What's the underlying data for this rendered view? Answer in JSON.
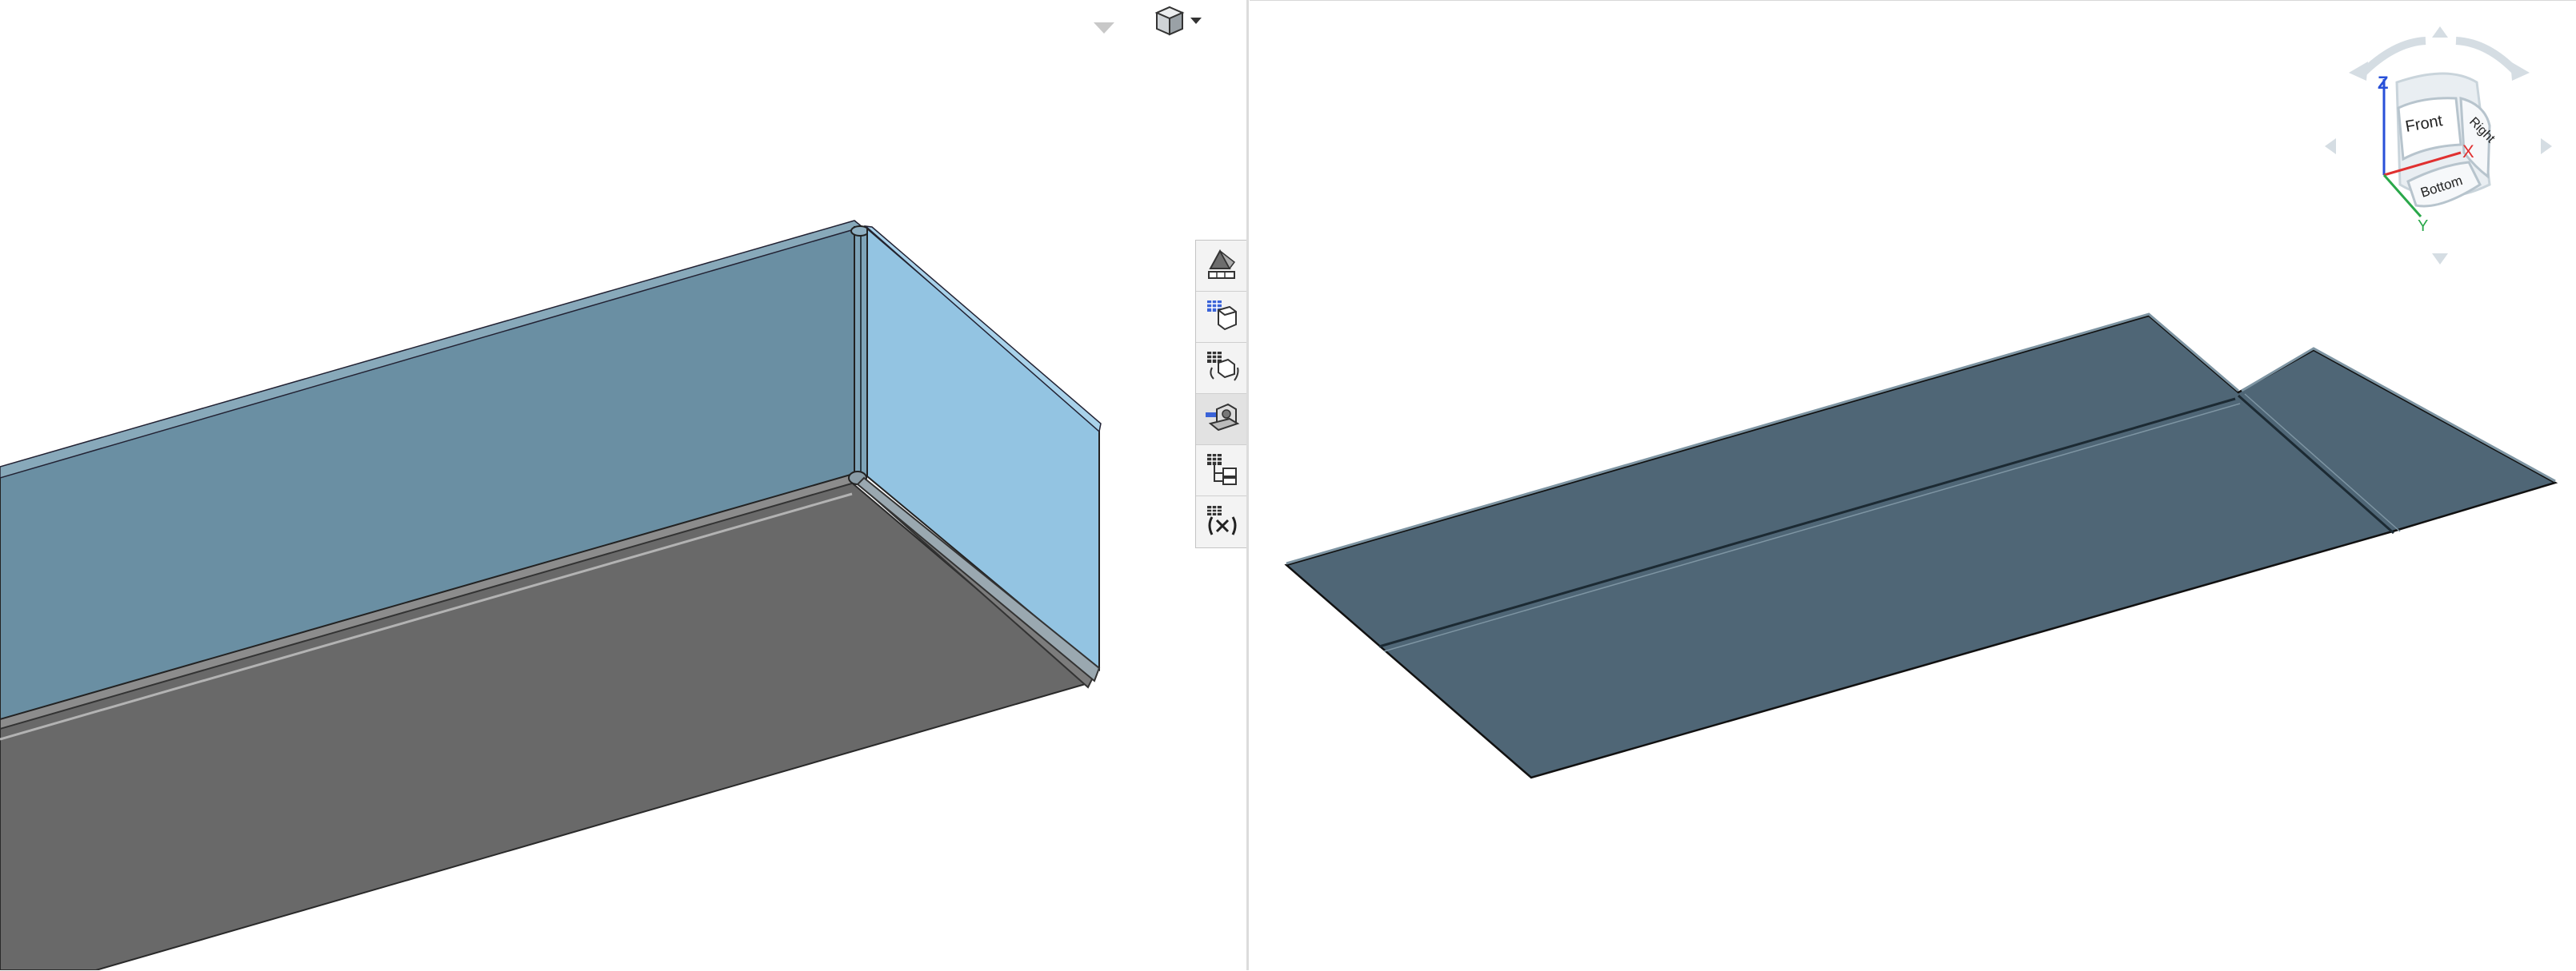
{
  "viewports": {
    "left": {
      "name": "3D model view"
    },
    "right": {
      "name": "Flat pattern view"
    }
  },
  "view_toolbar": {
    "view_cube_icon": "cube-icon",
    "dropdown_icon": "caret-down-icon",
    "collapse_icon": "chevron-down-icon"
  },
  "side_toolbar": {
    "tools": [
      {
        "icon": "appearance-icon"
      },
      {
        "icon": "mesh-cube-icon"
      },
      {
        "icon": "mesh-parts-icon"
      },
      {
        "icon": "section-view-icon"
      },
      {
        "icon": "mesh-tree-icon"
      },
      {
        "icon": "variables-icon"
      }
    ]
  },
  "nav_cube": {
    "faces": {
      "front": "Front",
      "right": "Right",
      "bottom": "Bottom"
    },
    "axes": {
      "x": "X",
      "y": "Y",
      "z": "Z"
    },
    "colors": {
      "x": "#e03030",
      "y": "#2aa84a",
      "z": "#2850d8"
    }
  },
  "colors": {
    "panel_blue": "#6a8fa3",
    "panel_blue_light": "#93c4e2",
    "base_gray": "#696969",
    "flat_pattern": "#4f6676"
  }
}
